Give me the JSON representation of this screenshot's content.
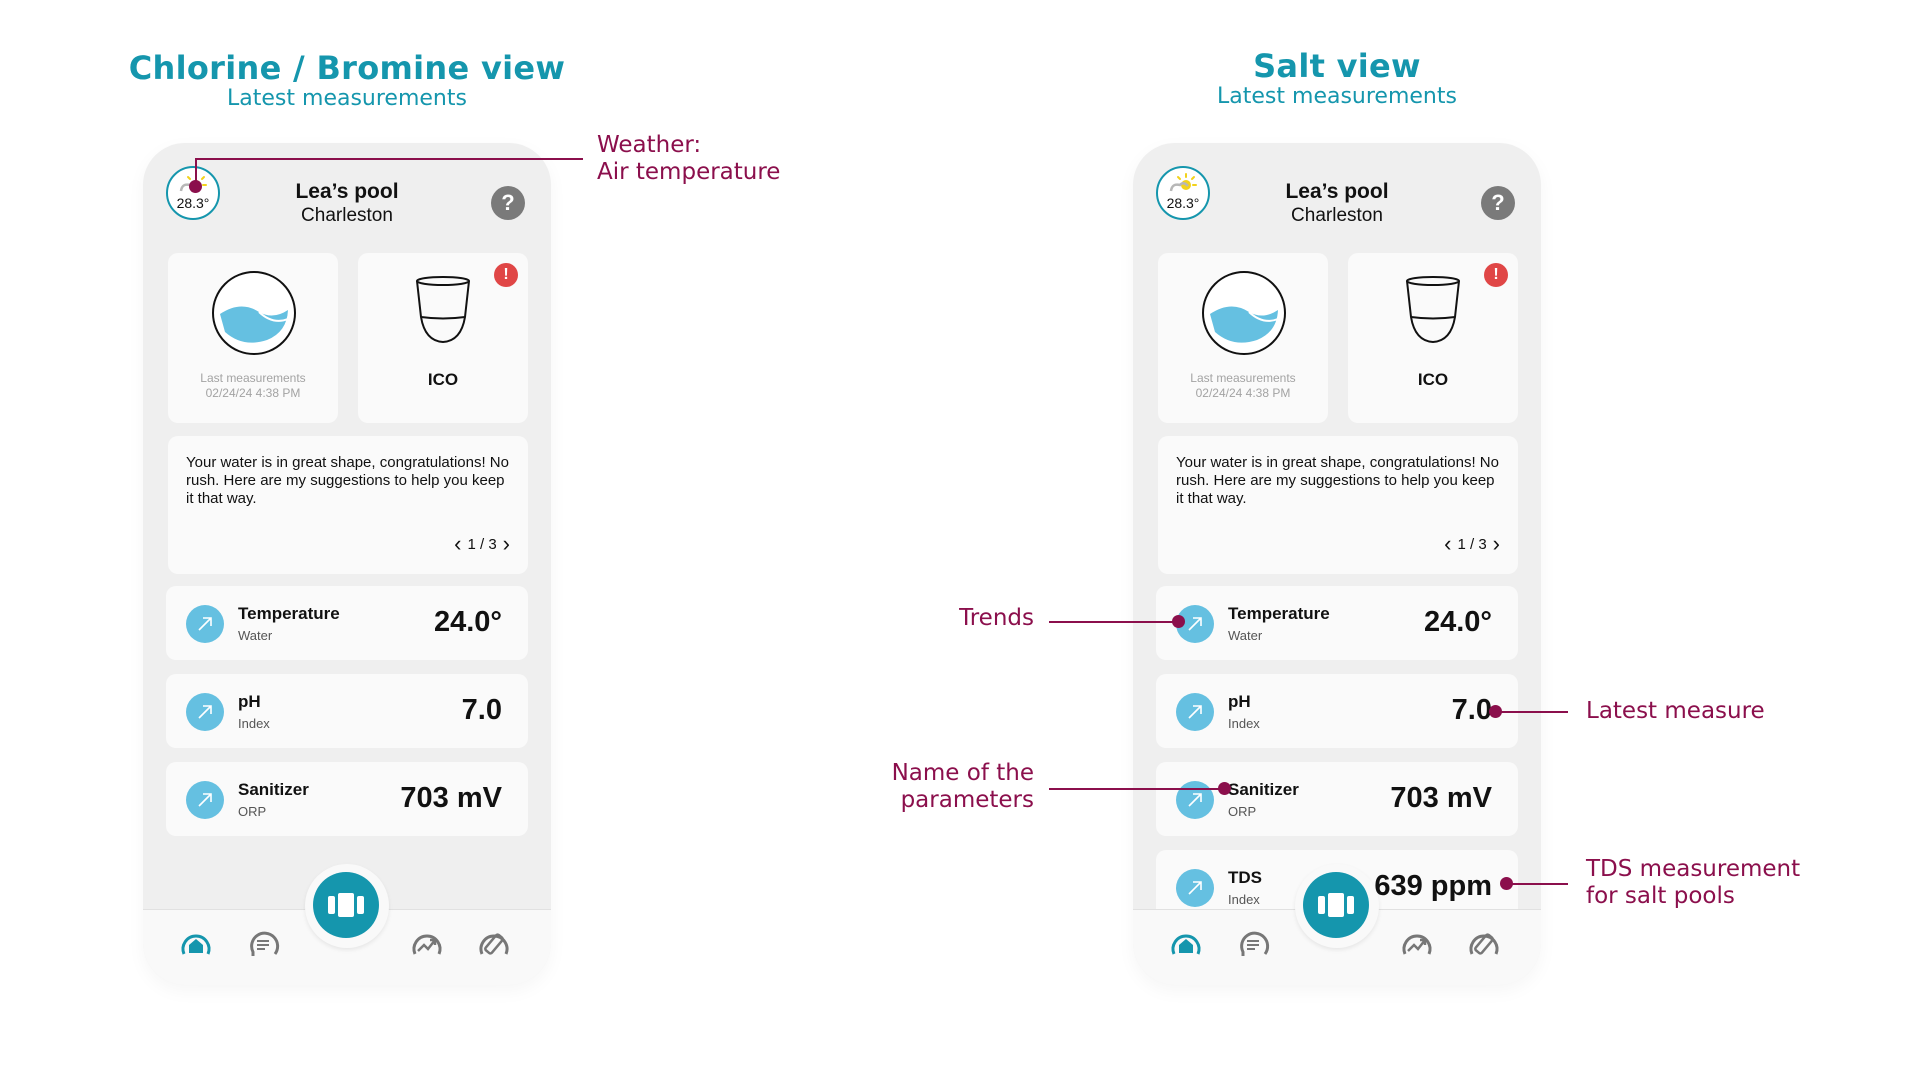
{
  "views": [
    {
      "title": "Chlorine / Bromine view",
      "subtitle": "Latest measurements",
      "phone": {
        "weather": {
          "icon": "partly-sunny-icon",
          "temperature": "28.3°"
        },
        "pool_name": "Lea’s pool",
        "city": "Charleston",
        "help_label": "?",
        "status_card": {
          "icon": "pool-water-icon",
          "label": "Last measurements",
          "timestamp": "02/24/24 4:38 PM"
        },
        "device_card": {
          "icon": "ico-device-icon",
          "label": "ICO",
          "alert": "!"
        },
        "tip": {
          "text": "Your water is in great shape, congratulations! No rush. Here are my suggestions to help you keep it that way.",
          "page": "1 / 3",
          "prev": "‹",
          "next": "›"
        },
        "parameters": [
          {
            "name": "Temperature",
            "sub": "Water",
            "value": "24.0°",
            "trend": "trend-up-icon"
          },
          {
            "name": "pH",
            "sub": "Index",
            "value": "7.0",
            "trend": "trend-up-icon"
          },
          {
            "name": "Sanitizer",
            "sub": "ORP",
            "value": "703 mV",
            "trend": "trend-up-icon"
          }
        ],
        "nav": [
          "home",
          "chat",
          "measure",
          "trends",
          "device"
        ]
      }
    },
    {
      "title": "Salt view",
      "subtitle": "Latest measurements",
      "phone": {
        "weather": {
          "icon": "partly-sunny-icon",
          "temperature": "28.3°"
        },
        "pool_name": "Lea’s pool",
        "city": "Charleston",
        "help_label": "?",
        "status_card": {
          "icon": "pool-water-icon",
          "label": "Last measurements",
          "timestamp": "02/24/24 4:38 PM"
        },
        "device_card": {
          "icon": "ico-device-icon",
          "label": "ICO",
          "alert": "!"
        },
        "tip": {
          "text": "Your water is in great shape, congratulations! No rush. Here are my suggestions to help you keep it that way.",
          "page": "1 / 3",
          "prev": "‹",
          "next": "›"
        },
        "parameters": [
          {
            "name": "Temperature",
            "sub": "Water",
            "value": "24.0°",
            "trend": "trend-up-icon"
          },
          {
            "name": "pH",
            "sub": "Index",
            "value": "7.0",
            "trend": "trend-up-icon"
          },
          {
            "name": "Sanitizer",
            "sub": "ORP",
            "value": "703 mV",
            "trend": "trend-up-icon"
          },
          {
            "name": "TDS",
            "sub": "Index",
            "value": "639 ppm",
            "trend": "trend-up-icon"
          }
        ],
        "nav": [
          "home",
          "chat",
          "measure",
          "trends",
          "device"
        ]
      }
    }
  ],
  "annotations": {
    "weather": [
      "Weather:",
      "Air temperature"
    ],
    "trends": "Trends",
    "latest_measure": "Latest measure",
    "param_name": [
      "Name of the",
      "parameters"
    ],
    "tds": [
      "TDS measurement",
      "for salt pools"
    ]
  },
  "colors": {
    "brand_teal": "#1596ad",
    "annotation": "#8b0f4c",
    "trend_blue": "#65c0e1",
    "alert_red": "#e04646"
  }
}
